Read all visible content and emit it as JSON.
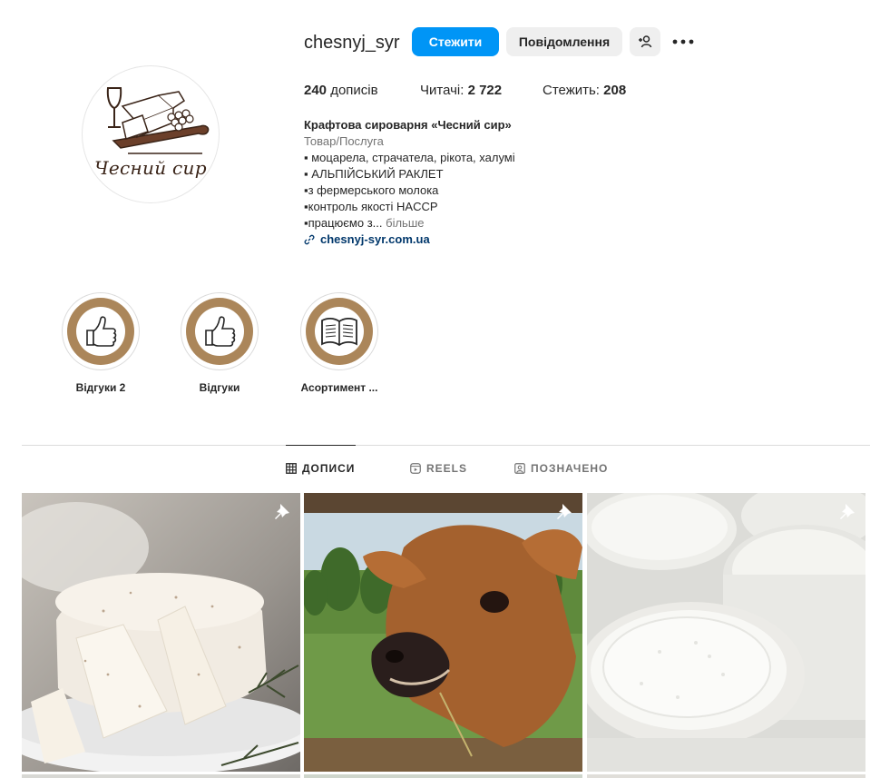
{
  "profile": {
    "username": "chesnyj_syr",
    "avatar_brand_text": "Чесний сир",
    "follow_label": "Стежити",
    "message_label": "Повідомлення",
    "suggest_icon": "person-plus-icon",
    "more_icon": "more-horizontal-icon"
  },
  "stats": [
    {
      "value": "240",
      "label": " дописів"
    },
    {
      "label": "Читачі: ",
      "value": "2 722"
    },
    {
      "label": "Стежить: ",
      "value": "208"
    }
  ],
  "bio": {
    "name": "Крафтова сироварня «Чесний сир»",
    "category": "Товар/Послуга",
    "lines": [
      "▪ моцарела, страчатела, рікота, халумі",
      "▪ АЛЬПІЙСЬКИЙ РАКЛЕТ",
      "▪з фермерського молока",
      "▪контроль якості HACCP"
    ],
    "truncated_line": "▪працюємо з...",
    "more_label": " більше",
    "link": "chesnyj-syr.com.ua",
    "link_icon": "link-icon"
  },
  "highlights": [
    {
      "label": "Відгуки 2",
      "icon": "thumbs-up-icon"
    },
    {
      "label": "Відгуки",
      "icon": "thumbs-up-icon"
    },
    {
      "label": "Асортимент ...",
      "icon": "open-book-icon"
    }
  ],
  "tabs": [
    {
      "label": "ДОПИСИ",
      "icon": "grid-icon",
      "active": true
    },
    {
      "label": "REELS",
      "icon": "reels-icon",
      "active": false
    },
    {
      "label": "ПОЗНАЧЕНО",
      "icon": "tagged-icon",
      "active": false
    }
  ],
  "posts": [
    {
      "subject": "ricotta-cheese-photo",
      "pinned": true
    },
    {
      "subject": "calf-photo",
      "pinned": true
    },
    {
      "subject": "ricotta-cups-photo",
      "pinned": true
    }
  ],
  "colors": {
    "accent": "#0095f6",
    "highlight_ring": "#ab865a",
    "link": "#00376b",
    "muted": "#737373"
  }
}
